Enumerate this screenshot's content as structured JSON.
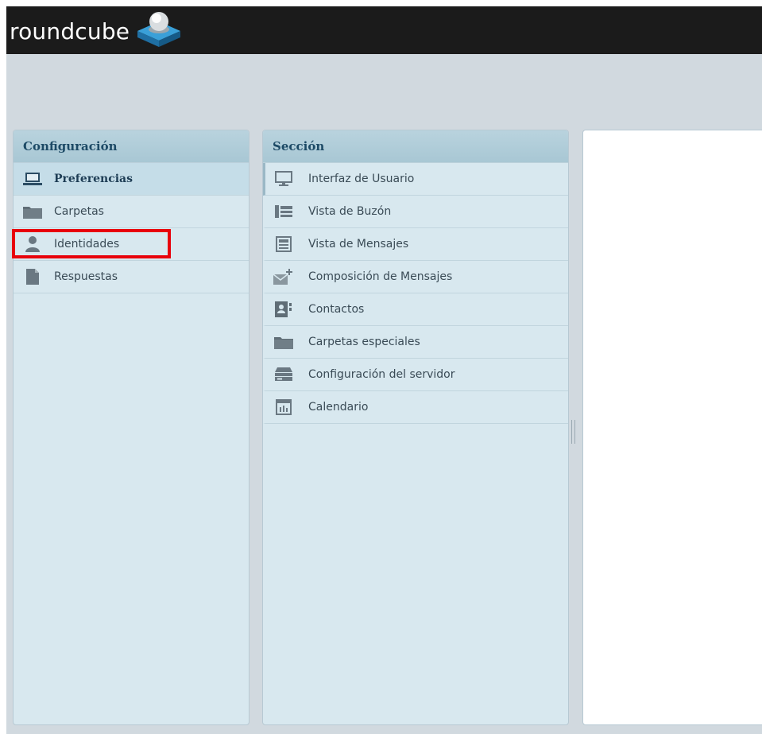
{
  "app": {
    "logo_text": "roundcube"
  },
  "colors": {
    "accent": "#1d4a66",
    "highlight": "#e8000b",
    "topbar": "#1b1b1b"
  },
  "config_panel": {
    "title": "Configuración",
    "items": [
      {
        "label": "Preferencias",
        "icon": "laptop-icon",
        "selected": true
      },
      {
        "label": "Carpetas",
        "icon": "folder-icon"
      },
      {
        "label": "Identidades",
        "icon": "user-icon",
        "highlighted": true
      },
      {
        "label": "Respuestas",
        "icon": "document-icon"
      }
    ]
  },
  "section_panel": {
    "title": "Sección",
    "items": [
      {
        "label": "Interfaz de Usuario",
        "icon": "monitor-icon"
      },
      {
        "label": "Vista de Buzón",
        "icon": "mailbox-list-icon"
      },
      {
        "label": "Vista de Mensajes",
        "icon": "message-view-icon"
      },
      {
        "label": "Composición de Mensajes",
        "icon": "compose-mail-icon"
      },
      {
        "label": "Contactos",
        "icon": "contacts-icon"
      },
      {
        "label": "Carpetas especiales",
        "icon": "folder-icon"
      },
      {
        "label": "Configuración del servidor",
        "icon": "server-icon"
      },
      {
        "label": "Calendario",
        "icon": "calendar-icon"
      }
    ]
  }
}
